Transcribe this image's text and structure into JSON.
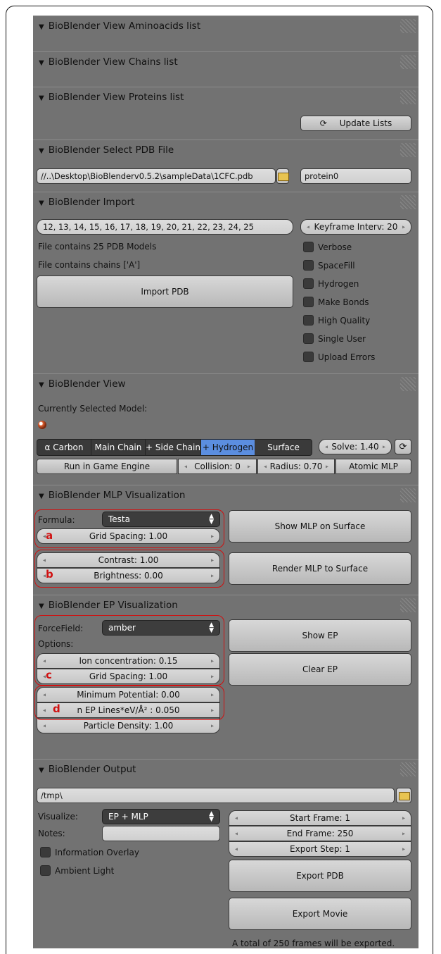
{
  "panels": {
    "aminoacids": "BioBlender View Aminoacids list",
    "chains": "BioBlender View Chains list",
    "proteins": "BioBlender View Proteins list",
    "select_pdb": "BioBlender Select PDB File",
    "import": "BioBlender Import",
    "view": "BioBlender View",
    "mlp": "BioBlender MLP Visualization",
    "ep": "BioBlender EP Visualization",
    "output": "BioBlender Output"
  },
  "proteins": {
    "update_lists": "Update Lists"
  },
  "select_pdb": {
    "path": "//..\\Desktop\\BioBlenderv0.5.2\\sampleData\\1CFC.pdb",
    "name": "protein0"
  },
  "import": {
    "models": "12, 13, 14, 15, 16, 17, 18, 19, 20, 21, 22, 23, 24, 25",
    "keyframe": "Keyframe Interv: 20",
    "info1": "File contains 25 PDB Models",
    "info2": "File contains chains ['A']",
    "import_btn": "Import PDB",
    "checks": [
      "Verbose",
      "SpaceFill",
      "Hydrogen",
      "Make Bonds",
      "High Quality",
      "Single User",
      "Upload Errors"
    ]
  },
  "view": {
    "selected_label": "Currently Selected Model:",
    "segments": [
      "α Carbon",
      "Main Chain",
      "+ Side Chain",
      "+ Hydrogen",
      "Surface"
    ],
    "solve": "Solve: 1.40",
    "run_game": "Run in Game Engine",
    "collision": "Collision: 0",
    "radius": "Radius: 0.70",
    "atomic_mlp": "Atomic MLP"
  },
  "mlp": {
    "formula_label": "Formula:",
    "formula_value": "Testa",
    "grid_spacing": "Grid Spacing: 1.00",
    "contrast": "Contrast: 1.00",
    "brightness": "Brightness: 0.00",
    "show_btn": "Show MLP on Surface",
    "render_btn": "Render MLP to Surface"
  },
  "ep": {
    "forcefield_label": "ForceField:",
    "forcefield_value": "amber",
    "options_label": "Options:",
    "ion": "Ion concentration: 0.15",
    "grid_spacing": "Grid Spacing: 1.00",
    "min_potential": "Minimum Potential: 0.00",
    "ep_lines": "n EP Lines*eV/Å² : 0.050",
    "particle": "Particle Density: 1.00",
    "show_btn": "Show EP",
    "clear_btn": "Clear EP"
  },
  "output": {
    "path": "/tmp\\",
    "visualize_label": "Visualize:",
    "visualize_value": "EP + MLP",
    "notes_label": "Notes:",
    "info_overlay": "Information Overlay",
    "ambient": "Ambient Light",
    "start_frame": "Start Frame: 1",
    "end_frame": "End Frame: 250",
    "export_step": "Export Step: 1",
    "export_pdb": "Export PDB",
    "export_movie": "Export Movie",
    "total": "A total of 250 frames will be exported."
  },
  "annotations": {
    "a": "a",
    "b": "b",
    "c": "c",
    "d": "d"
  },
  "colors": {
    "panel_bg": "#727272",
    "highlight": "#5b8ee0",
    "annotation": "#d01010"
  }
}
